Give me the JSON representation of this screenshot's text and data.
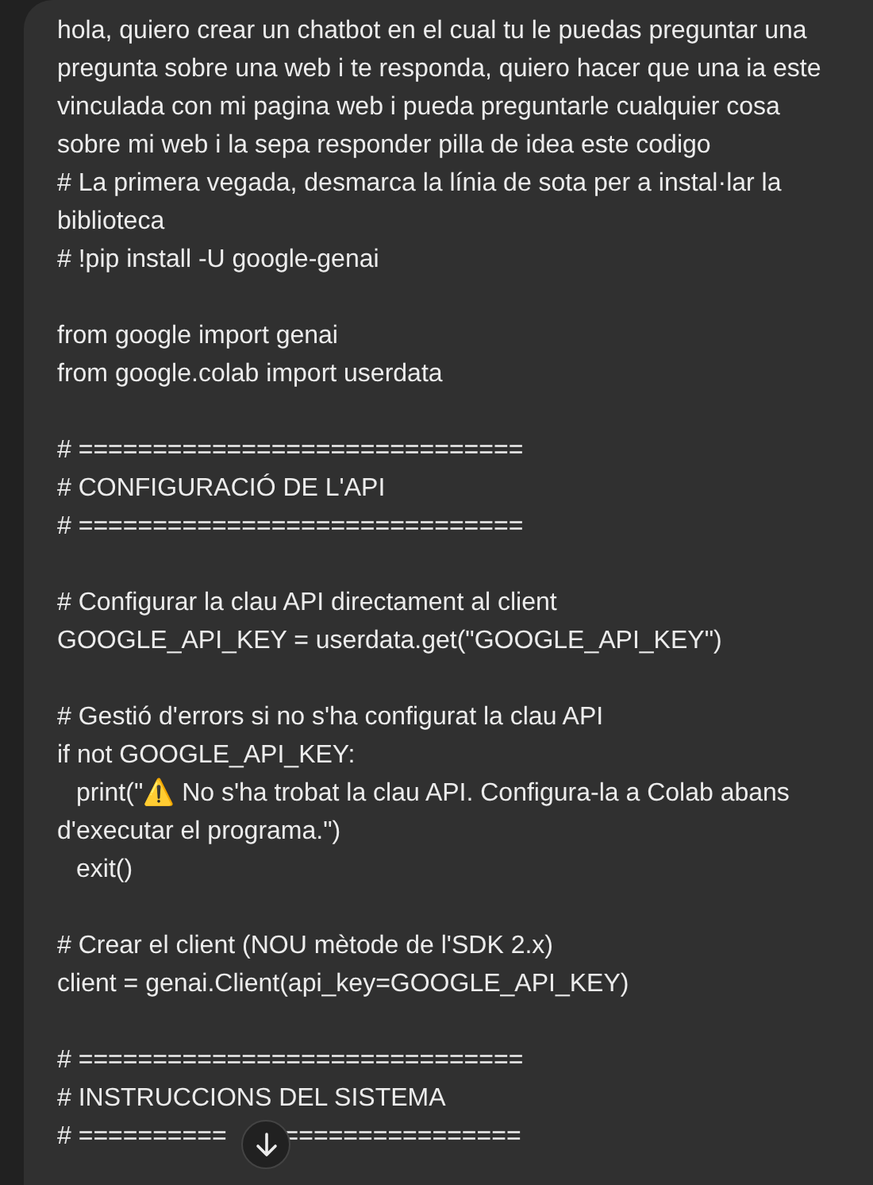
{
  "message": {
    "blocks": [
      [
        {
          "text": "hola, quiero crear un chatbot en el cual tu le puedas preguntar una pregunta sobre una web i te responda, quiero hacer que una ia este vinculada con mi pagina web i pueda preguntarle cualquier cosa sobre mi web i la sepa responder pilla de idea este codigo",
          "indent": false
        },
        {
          "text": "# La primera vegada, desmarca la línia de sota per a instal·lar la biblioteca",
          "indent": false
        },
        {
          "text": "# !pip install -U google-genai",
          "indent": false
        }
      ],
      [
        {
          "text": "from google import genai",
          "indent": false
        },
        {
          "text": "from google.colab import userdata",
          "indent": false
        }
      ],
      [
        {
          "text": "# ==============================",
          "indent": false
        },
        {
          "text": "# CONFIGURACIÓ DE L'API",
          "indent": false
        },
        {
          "text": "# ==============================",
          "indent": false
        }
      ],
      [
        {
          "text": "# Configurar la clau API directament al client",
          "indent": false
        },
        {
          "text": "GOOGLE_API_KEY = userdata.get(\"GOOGLE_API_KEY\")",
          "indent": false
        }
      ],
      [
        {
          "text": "# Gestió d'errors si no s'ha configurat la clau API",
          "indent": false
        },
        {
          "text": "if not GOOGLE_API_KEY:",
          "indent": false
        },
        {
          "text": "print(\"⚠️ No s'ha trobat la clau API. Configura-la a Colab abans d'executar el programa.\")",
          "indent": true
        },
        {
          "text": "exit()",
          "indent": true
        }
      ],
      [
        {
          "text": "# Crear el client (NOU mètode de l'SDK 2.x)",
          "indent": false
        },
        {
          "text": "client = genai.Client(api_key=GOOGLE_API_KEY)",
          "indent": false
        }
      ],
      [
        {
          "text": "# ==============================",
          "indent": false
        },
        {
          "text": "# INSTRUCCIONS DEL SISTEMA",
          "indent": false
        },
        {
          "parts": [
            "# ==========",
            "================"
          ],
          "indent": false
        }
      ]
    ]
  }
}
